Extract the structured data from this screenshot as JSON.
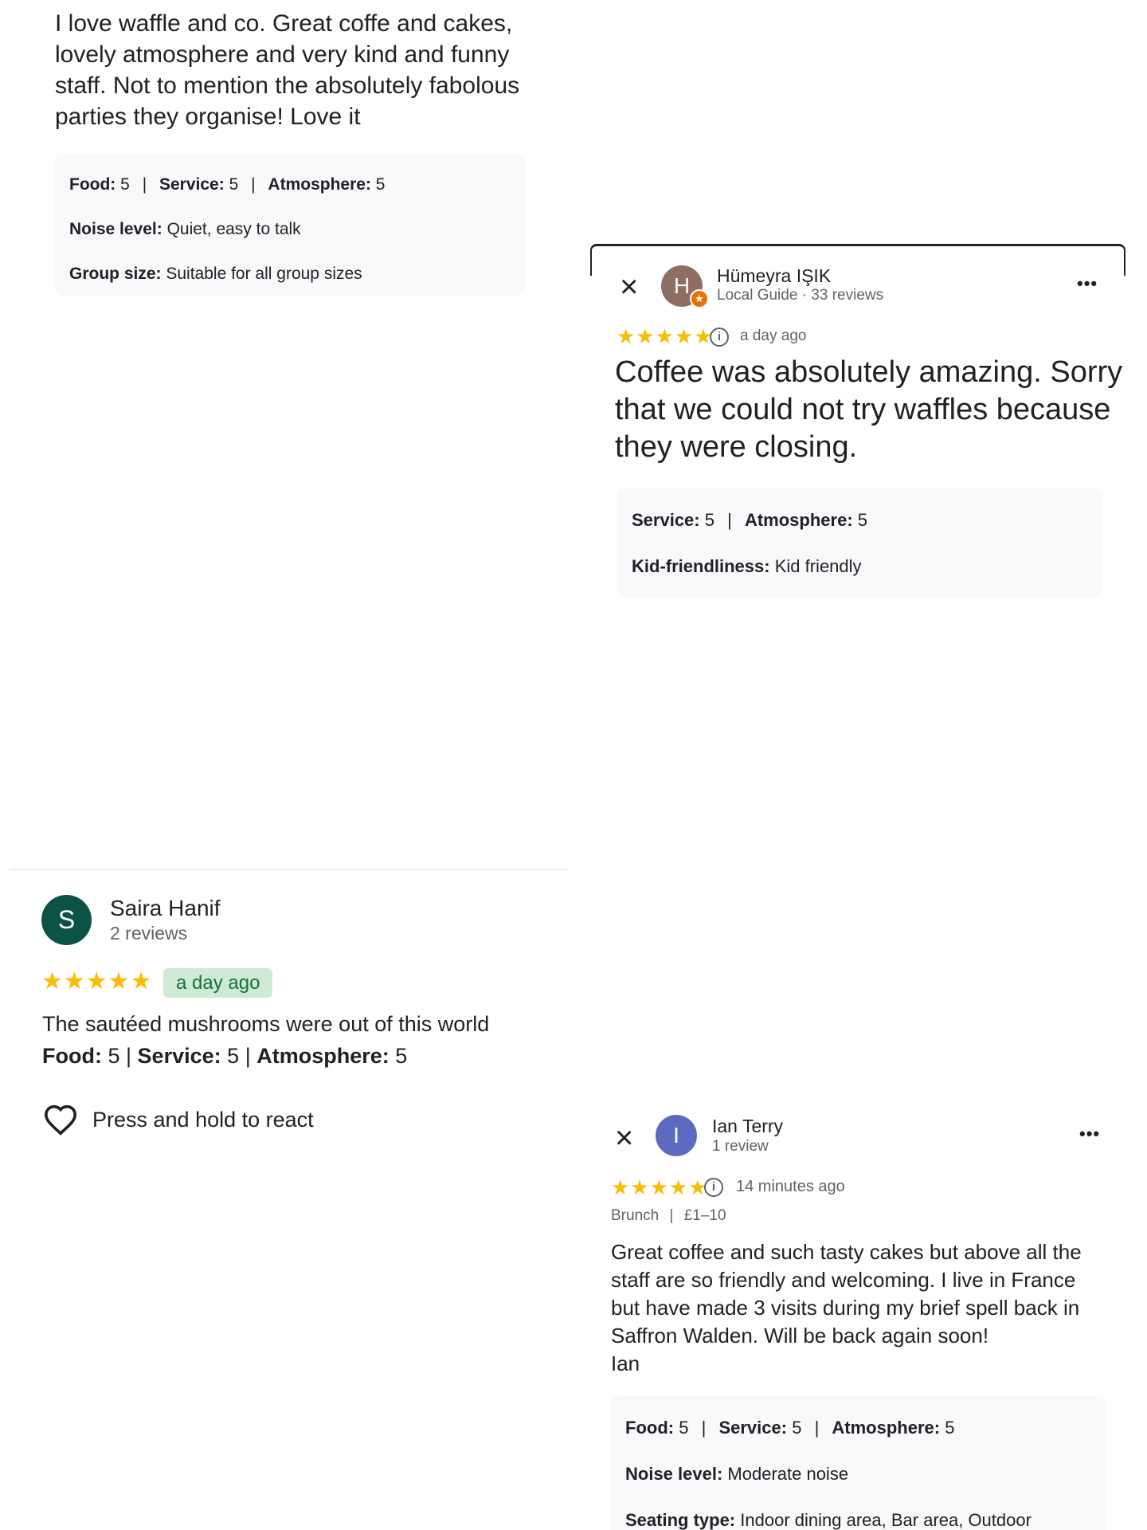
{
  "panel1": {
    "review_text": "I love waffle and co. Great coffe and cakes, lovely atmosphere and very kind and funny staff. Not to mention the absolutely fabolous parties they organise! Love it",
    "ratings": [
      {
        "label": "Food:",
        "value": "5"
      },
      {
        "label": "Service:",
        "value": "5"
      },
      {
        "label": "Atmosphere:",
        "value": "5"
      }
    ],
    "noise": {
      "label": "Noise level:",
      "value": "Quiet, easy to talk"
    },
    "group": {
      "label": "Group size:",
      "value": "Suitable for all group sizes"
    }
  },
  "panel2": {
    "close_icon": "×",
    "avatar_letter": "H",
    "avatar_color": "#8d6e63",
    "reviewer_name": "Hümeyra IŞIK",
    "reviewer_meta": "Local Guide · 33 reviews",
    "more_icon": "•••",
    "stars": "★★★★★",
    "info_icon": "i",
    "time_ago": "a day ago",
    "review_text": "Coffee was absolutely amazing. Sorry that we could not try waffles because they were closing.",
    "ratings": [
      {
        "label": "Service:",
        "value": "5"
      },
      {
        "label": "Atmosphere:",
        "value": "5"
      }
    ],
    "kid": {
      "label": "Kid-friendliness:",
      "value": "Kid friendly"
    }
  },
  "panel3": {
    "avatar_letter": "S",
    "avatar_color": "#0b5345",
    "reviewer_name": "Saira Hanif",
    "reviewer_meta": "2 reviews",
    "stars": "★★★★★",
    "time_ago": "a day ago",
    "review_text": "The sautéed mushrooms were out of this world",
    "ratings": [
      {
        "label": "Food:",
        "value": "5"
      },
      {
        "label": "Service:",
        "value": "5"
      },
      {
        "label": "Atmosphere:",
        "value": "5"
      }
    ],
    "react_label": "Press and hold to react"
  },
  "panel4": {
    "close_icon": "×",
    "avatar_letter": "I",
    "avatar_color": "#5c6bc0",
    "reviewer_name": "Ian Terry",
    "reviewer_meta": "1 review",
    "more_icon": "•••",
    "stars": "★★★★★",
    "info_icon": "i",
    "time_ago": "14 minutes ago",
    "meal_type": "Brunch",
    "price": "£1–10",
    "review_text": "Great coffee and such tasty cakes but above all the staff are so friendly and welcoming. I live in France but have made 3 visits during my brief spell back in Saffron Walden. Will be back again soon!",
    "signature": "Ian",
    "ratings": [
      {
        "label": "Food:",
        "value": "5"
      },
      {
        "label": "Service:",
        "value": "5"
      },
      {
        "label": "Atmosphere:",
        "value": "5"
      }
    ],
    "noise": {
      "label": "Noise level:",
      "value": "Moderate noise"
    },
    "seating": {
      "label": "Seating type:",
      "value": "Indoor dining area, Bar area, Outdoor"
    }
  }
}
